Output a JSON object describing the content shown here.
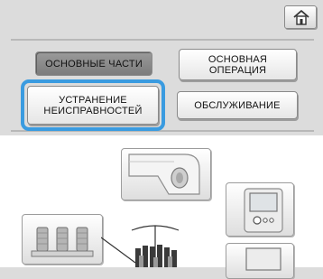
{
  "header": {
    "home_icon": "home-icon"
  },
  "menu": {
    "basic_parts": "ОСНОВНЫЕ ЧАСТИ",
    "basic_operation": "ОСНОВНАЯ\nОПЕРАЦИЯ",
    "troubleshooting": "УСТРАНЕНИЕ\nНЕИСПРАВНОСТЕЙ",
    "maintenance": "ОБСЛУЖИВАНИЕ",
    "selected": "troubleshooting"
  },
  "illustrations": [
    "machine-arm-tile",
    "control-panel-tile",
    "thread-spools-tile",
    "spool-stand",
    "display-tile"
  ],
  "colors": {
    "background": "#dcdcdc",
    "selection": "#3a9be0",
    "illustration_area": "#ffffff",
    "dark_button": "#8a8a8a"
  }
}
